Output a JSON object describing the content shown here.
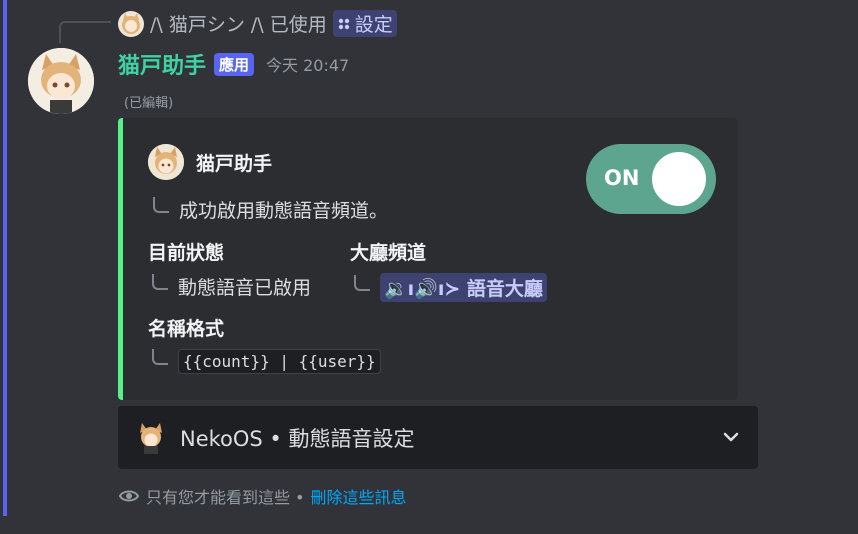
{
  "reply": {
    "user": "/\\ 猫戸シン /\\",
    "used_text": "已使用",
    "command": "設定"
  },
  "message": {
    "author": "猫戸助手",
    "badge": "應用",
    "timestamp": "今天 20:47",
    "edited": "(已編輯)"
  },
  "embed": {
    "accent_color": "#57f287",
    "author_name": "猫戸助手",
    "description": "成功啟用動態語音頻道。",
    "toggle_label": "ON",
    "fields": [
      {
        "name": "目前狀態",
        "value": "動態語音已啟用"
      },
      {
        "name": "大廳頻道",
        "value": "🔉ı🔊ı≻ 語音大廳"
      },
      {
        "name": "名稱格式",
        "value": "{{count}} | {{user}}"
      }
    ]
  },
  "select": {
    "label": "NekoOS • 動態語音設定"
  },
  "ephemeral": {
    "notice": "只有您才能看到這些 •",
    "dismiss_link": "刪除這些訊息"
  },
  "colors": {
    "username": "#3fd3a3",
    "app_badge": "#5865f2",
    "toggle": "#5ea58f",
    "link": "#00a8fc"
  }
}
